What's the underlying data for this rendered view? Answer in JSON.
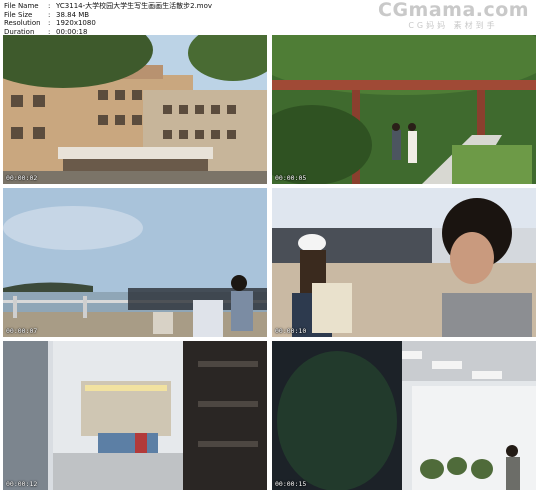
{
  "meta": {
    "rows": [
      {
        "key": "File Name",
        "value": "YC3114-大学校园大学生写生画画生活散步2.mov"
      },
      {
        "key": "File Size",
        "value": "38.84 MB"
      },
      {
        "key": "Resolution",
        "value": "1920x1080"
      },
      {
        "key": "Duration",
        "value": "00:00:18"
      }
    ]
  },
  "watermark": {
    "brand": "CGmama.com",
    "slogan": "CG妈妈 素材到手"
  },
  "thumbnails": [
    {
      "timecode": "00:00:02",
      "scene": "campus-building"
    },
    {
      "timecode": "00:00:05",
      "scene": "students-walking-pergola"
    },
    {
      "timecode": "00:00:07",
      "scene": "student-sketching-by-sea"
    },
    {
      "timecode": "00:00:10",
      "scene": "student-drawing-closeup"
    },
    {
      "timecode": "00:00:12",
      "scene": "lobby-interior"
    },
    {
      "timecode": "00:00:15",
      "scene": "atrium-interior"
    }
  ],
  "colors": {
    "background": "#ffffff",
    "timecode": "#ffffff",
    "watermark": "#c9c9c9"
  }
}
